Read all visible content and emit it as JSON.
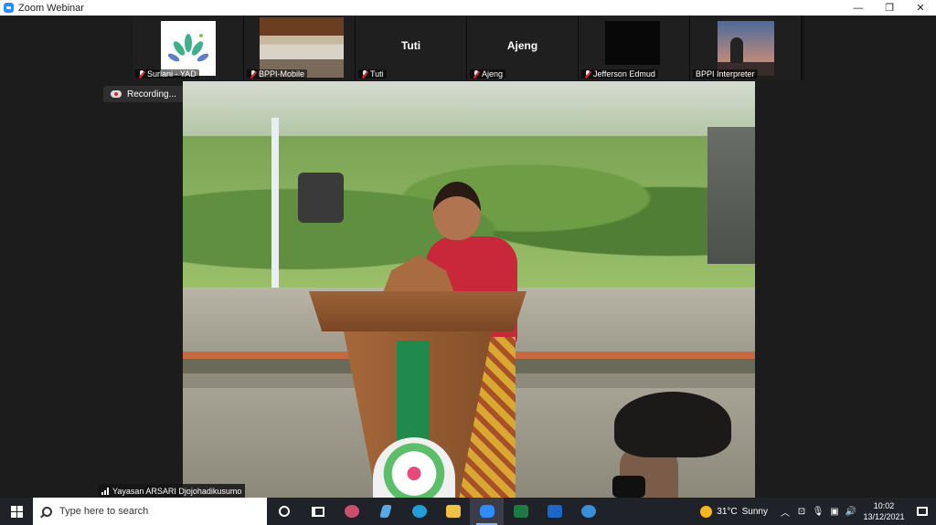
{
  "window": {
    "title": "Zoom Webinar",
    "buttons": {
      "minimize": "—",
      "restore": "❐",
      "close": "✕"
    }
  },
  "participants": [
    {
      "name": "Surlani - YAD",
      "display_text": "",
      "tile": "logo",
      "muted": true
    },
    {
      "name": "BPPI-Mobile",
      "display_text": "",
      "tile": "photo",
      "muted": true
    },
    {
      "name": "Tuti",
      "display_text": "Tuti",
      "tile": "name",
      "muted": true
    },
    {
      "name": "Ajeng",
      "display_text": "Ajeng",
      "tile": "name",
      "muted": true
    },
    {
      "name": "Jefferson Edmud",
      "display_text": "",
      "tile": "dark",
      "muted": true
    },
    {
      "name": "BPPI Interpreter",
      "display_text": "",
      "tile": "dusk",
      "muted": false
    }
  ],
  "recording": {
    "label": "Recording..."
  },
  "speaker": {
    "name": "Yayasan ARSARI Djojohadikusumo"
  },
  "taskbar": {
    "search_placeholder": "Type here to search",
    "apps": [
      {
        "name": "cortana",
        "active": false
      },
      {
        "name": "task-view",
        "active": false
      },
      {
        "name": "paint",
        "active": false,
        "color": "#c94f6d"
      },
      {
        "name": "shortcut",
        "active": false,
        "color": "#5aa9e6"
      },
      {
        "name": "edge",
        "active": false,
        "color": "#1f9fd6"
      },
      {
        "name": "file-explorer",
        "active": false,
        "color": "#f0c243"
      },
      {
        "name": "zoom",
        "active": true,
        "color": "#2d8cff"
      },
      {
        "name": "excel",
        "active": false,
        "color": "#1d7a45"
      },
      {
        "name": "outlook",
        "active": false,
        "color": "#1a67c8"
      },
      {
        "name": "help",
        "active": false,
        "color": "#3a8fd6"
      }
    ],
    "weather": {
      "temp": "31°C",
      "condition": "Sunny"
    },
    "clock": {
      "time": "10:02",
      "date": "13/12/2021"
    }
  }
}
